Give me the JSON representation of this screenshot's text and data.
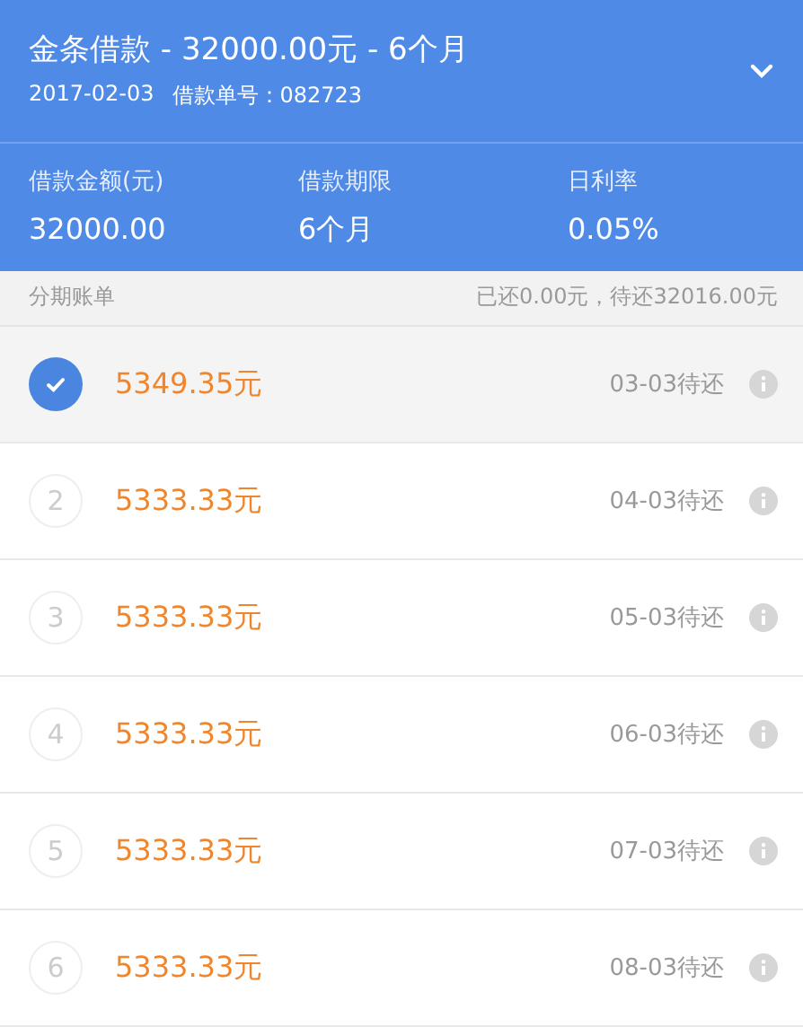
{
  "header": {
    "title": "金条借款 - 32000.00元 - 6个月",
    "date": "2017-02-03",
    "order_label": "借款单号：",
    "order_number": "082723",
    "expanded": false
  },
  "stats": [
    {
      "label": "借款金额(元)",
      "value": "32000.00"
    },
    {
      "label": "借款期限",
      "value": "6个月"
    },
    {
      "label": "日利率",
      "value": "0.05%"
    }
  ],
  "section": {
    "title": "分期账单",
    "summary": "已还0.00元，待还32016.00元"
  },
  "installments": [
    {
      "selected": true,
      "amount": "5349.35元",
      "due": "03-03待还"
    },
    {
      "number": "2",
      "selected": false,
      "amount": "5333.33元",
      "due": "04-03待还"
    },
    {
      "number": "3",
      "selected": false,
      "amount": "5333.33元",
      "due": "05-03待还"
    },
    {
      "number": "4",
      "selected": false,
      "amount": "5333.33元",
      "due": "06-03待还"
    },
    {
      "number": "5",
      "selected": false,
      "amount": "5333.33元",
      "due": "07-03待还"
    },
    {
      "number": "6",
      "selected": false,
      "amount": "5333.33元",
      "due": "08-03待还"
    }
  ]
}
